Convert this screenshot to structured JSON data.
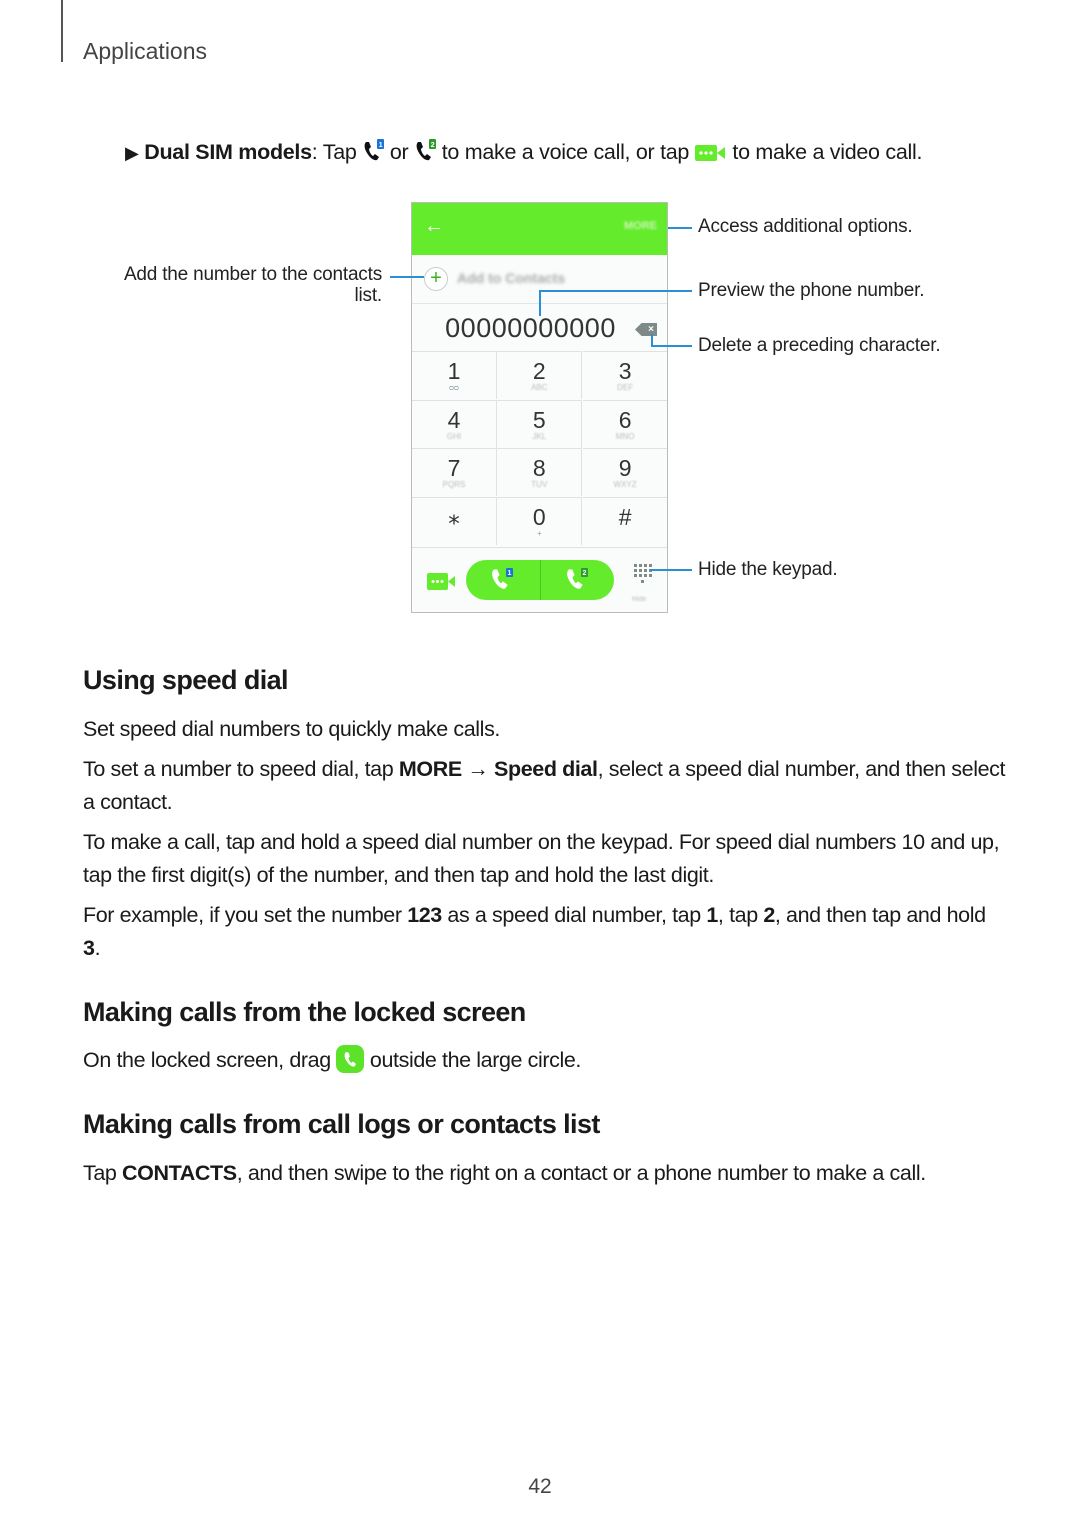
{
  "header": {
    "section": "Applications"
  },
  "intro": {
    "marker": "▶",
    "label_bold": "Dual SIM models",
    "seg1": ": Tap ",
    "seg2": " or ",
    "seg3": " to make a voice call, or tap ",
    "seg4": " to make a video call.",
    "icons": [
      "phone-sim1-icon",
      "phone-sim2-icon",
      "video-call-icon"
    ]
  },
  "phone": {
    "back": "←",
    "more": "MORE",
    "add_to_contacts": "Add to Contacts",
    "number": "00000000000",
    "backspace": "×",
    "keys": [
      {
        "d": "1",
        "s": "ᴑᴑ"
      },
      {
        "d": "2",
        "s": "ABC"
      },
      {
        "d": "3",
        "s": "DEF"
      },
      {
        "d": "4",
        "s": "GHI"
      },
      {
        "d": "5",
        "s": "JKL"
      },
      {
        "d": "6",
        "s": "MNO"
      },
      {
        "d": "7",
        "s": "PQRS"
      },
      {
        "d": "8",
        "s": "TUV"
      },
      {
        "d": "9",
        "s": "WXYZ"
      },
      {
        "d": "⁎",
        "s": ""
      },
      {
        "d": "0",
        "s": "+"
      },
      {
        "d": "#",
        "s": ""
      }
    ],
    "sim1": "1",
    "sim2": "2",
    "hide": "Hide"
  },
  "callouts": {
    "more": "Access additional options.",
    "add_line1": "Add the number to the contacts",
    "add_line2": "list.",
    "preview": "Preview the phone number.",
    "delete": "Delete a preceding character.",
    "hide": "Hide the keypad."
  },
  "colors": {
    "accent_green": "#64ec2c",
    "callout_blue": "#2a8fd4",
    "sim1_blue": "#1a73d9",
    "sim2_green": "#2d9a2d"
  },
  "sections": {
    "speed_dial": {
      "title": "Using speed dial",
      "p1": "Set speed dial numbers to quickly make calls.",
      "p2_a": "To set a number to speed dial, tap ",
      "p2_more": "MORE",
      "p2_arrow": " → ",
      "p2_speed": "Speed dial",
      "p2_b": ", select a speed dial number, and then select a contact.",
      "p3": "To make a call, tap and hold a speed dial number on the keypad. For speed dial numbers 10 and up, tap the first digit(s) of the number, and then tap and hold the last digit.",
      "p4_a": "For example, if you set the number ",
      "p4_123": "123",
      "p4_b": " as a speed dial number, tap ",
      "p4_1": "1",
      "p4_c": ", tap ",
      "p4_2": "2",
      "p4_d": ", and then tap and hold ",
      "p4_3": "3",
      "p4_e": "."
    },
    "locked": {
      "title": "Making calls from the locked screen",
      "p_a": "On the locked screen, drag ",
      "p_b": " outside the large circle."
    },
    "logs": {
      "title": "Making calls from call logs or contacts list",
      "p_a": "Tap ",
      "p_contacts": "CONTACTS",
      "p_b": ", and then swipe to the right on a contact or a phone number to make a call."
    }
  },
  "page_number": "42"
}
